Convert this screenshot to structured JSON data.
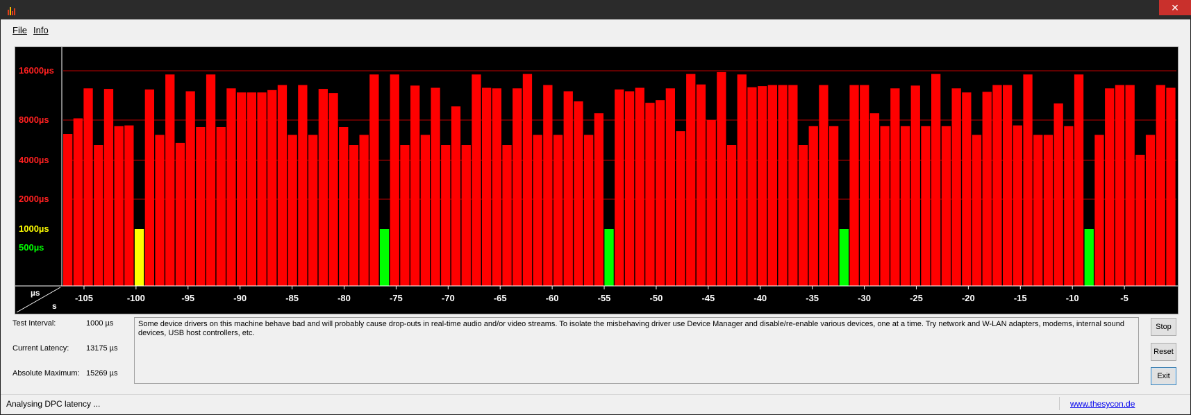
{
  "window": {
    "close_glyph": "✕"
  },
  "menu": {
    "file": "File",
    "info": "Info"
  },
  "chart_data": {
    "type": "bar",
    "y_axis_labels": [
      {
        "label": "16000µs",
        "value": 16000,
        "color": "#ff2020"
      },
      {
        "label": "8000µs",
        "value": 8000,
        "color": "#ff2020"
      },
      {
        "label": "4000µs",
        "value": 4000,
        "color": "#ff2020"
      },
      {
        "label": "2000µs",
        "value": 2000,
        "color": "#ff2020"
      },
      {
        "label": "1000µs",
        "value": 1000,
        "color": "#ffff00"
      },
      {
        "label": "500µs",
        "value": 500,
        "color": "#00ff00"
      }
    ],
    "corner_labels": {
      "top": "µs",
      "bottom": "s"
    },
    "x_ticks": [
      "-105",
      "-100",
      "-95",
      "-90",
      "-85",
      "-80",
      "-75",
      "-70",
      "-65",
      "-60",
      "-55",
      "-50",
      "-45",
      "-40",
      "-35",
      "-30",
      "-25",
      "-20",
      "-15",
      "-10",
      "-5"
    ],
    "x_range": [
      -107,
      0
    ],
    "ylim": [
      0,
      16000
    ],
    "ylabel": "µs",
    "xlabel": "s",
    "colors": {
      "high": "#ff0000",
      "medium": "#ffff00",
      "low": "#00ff00",
      "grid": "#c00000",
      "background": "#000000"
    },
    "values": [
      6300,
      8200,
      12500,
      5200,
      12400,
      7200,
      7300,
      1000,
      12300,
      6200,
      15200,
      5400,
      12000,
      7100,
      15200,
      7100,
      12500,
      11800,
      11800,
      11800,
      12200,
      13100,
      6200,
      13100,
      6200,
      12400,
      11700,
      7100,
      5200,
      6200,
      15200,
      1000,
      15200,
      5200,
      13000,
      6200,
      12600,
      5200,
      9700,
      5200,
      15200,
      12600,
      12500,
      5200,
      12500,
      15300,
      6200,
      13100,
      6200,
      12000,
      10400,
      6200,
      8800,
      1000,
      12300,
      12000,
      12600,
      10200,
      10600,
      12500,
      6600,
      15300,
      13200,
      8000,
      15700,
      5200,
      15200,
      12700,
      12900,
      13100,
      13100,
      13100,
      5200,
      7200,
      13100,
      7200,
      1000,
      13100,
      13100,
      8800,
      7200,
      12500,
      7200,
      13000,
      7200,
      15300,
      7200,
      12500,
      11800,
      6200,
      11900,
      13100,
      13100,
      7300,
      15200,
      6200,
      6200,
      10100,
      7200,
      15200,
      1000,
      6200,
      12500,
      13100,
      13100,
      4400,
      6200,
      13100,
      12600
    ],
    "bar_colors": [
      "high",
      "high",
      "high",
      "high",
      "high",
      "high",
      "high",
      "medium",
      "high",
      "high",
      "high",
      "high",
      "high",
      "high",
      "high",
      "high",
      "high",
      "high",
      "high",
      "high",
      "high",
      "high",
      "high",
      "high",
      "high",
      "high",
      "high",
      "high",
      "high",
      "high",
      "high",
      "low",
      "high",
      "high",
      "high",
      "high",
      "high",
      "high",
      "high",
      "high",
      "high",
      "high",
      "high",
      "high",
      "high",
      "high",
      "high",
      "high",
      "high",
      "high",
      "high",
      "high",
      "high",
      "low",
      "high",
      "high",
      "high",
      "high",
      "high",
      "high",
      "high",
      "high",
      "high",
      "high",
      "high",
      "high",
      "high",
      "high",
      "high",
      "high",
      "high",
      "high",
      "high",
      "high",
      "high",
      "high",
      "low",
      "high",
      "high",
      "high",
      "high",
      "high",
      "high",
      "high",
      "high",
      "high",
      "high",
      "high",
      "high",
      "high",
      "high",
      "high",
      "high",
      "high",
      "high",
      "high",
      "high",
      "high",
      "high",
      "high",
      "low",
      "high",
      "high",
      "high",
      "high",
      "high",
      "high",
      "high",
      "high"
    ]
  },
  "stats": {
    "test_interval_label": "Test Interval:",
    "test_interval_value": "1000 µs",
    "current_latency_label": "Current Latency:",
    "current_latency_value": "13175 µs",
    "absolute_maximum_label": "Absolute Maximum:",
    "absolute_maximum_value": "15269 µs"
  },
  "message": "Some device drivers on this machine behave bad and will probably cause drop-outs in real-time audio and/or video streams. To isolate the misbehaving driver use Device Manager and disable/re-enable various devices, one at a time. Try network and W-LAN adapters, modems, internal sound devices, USB host controllers, etc.",
  "buttons": {
    "stop": "Stop",
    "reset": "Reset",
    "exit": "Exit"
  },
  "status": {
    "text": "Analysing DPC latency ...",
    "link": "www.thesycon.de"
  }
}
